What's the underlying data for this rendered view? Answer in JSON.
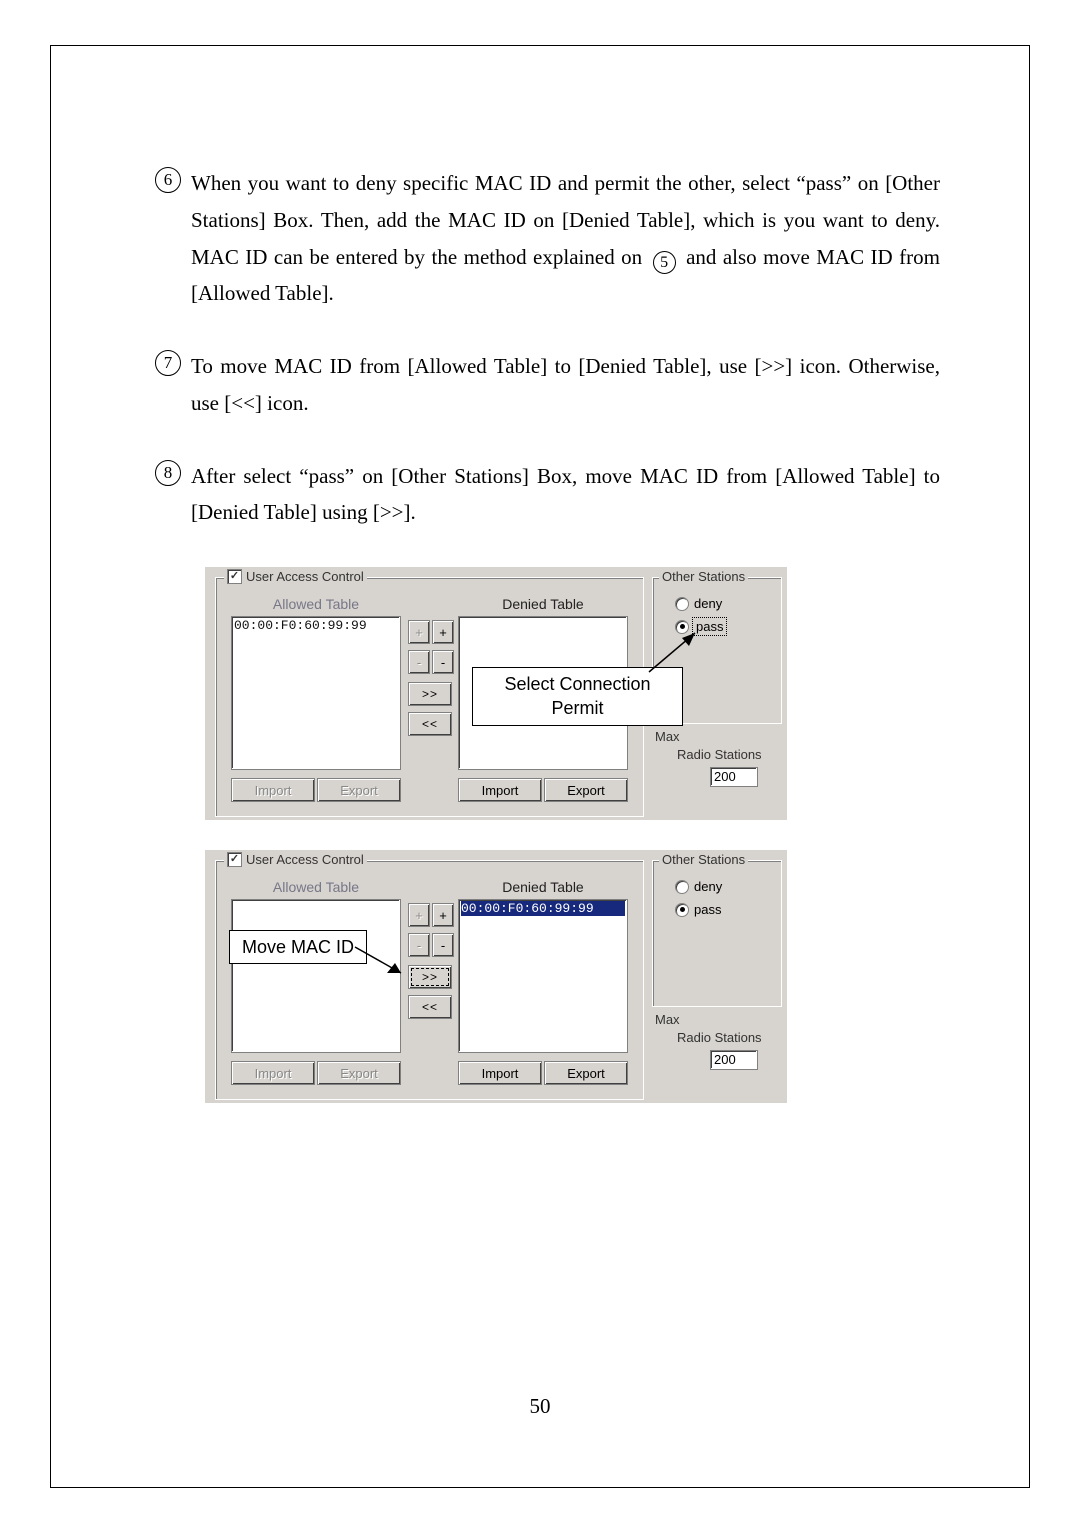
{
  "bullets": {
    "b6": {
      "num": "6",
      "text_a": "When you want to deny specific MAC ID and permit the other, select “pass” on [Other Stations] Box. Then, add the MAC ID on [Denied Table], which is you want to deny. MAC ID can be entered by the method explained on ",
      "ref_num": "5",
      "text_b": " and also move MAC ID from [Allowed Table]."
    },
    "b7": {
      "num": "7",
      "text": "To move MAC ID from [Allowed Table] to [Denied Table], use [>>] icon. Otherwise, use [<<] icon."
    },
    "b8": {
      "num": "8",
      "text": "After select “pass” on [Other Stations] Box, move MAC ID from [Allowed Table] to [Denied Table] using [>>]."
    }
  },
  "ui": {
    "group_title": "User Access Control",
    "allowed_title": "Allowed Table",
    "denied_title": "Denied Table",
    "other_title": "Other Stations",
    "mac_id": "00:00:F0:60:99:99",
    "btn_plus": "+",
    "btn_minus": "-",
    "btn_right": ">>",
    "btn_left": "<<",
    "btn_import": "Import",
    "btn_export": "Export",
    "radio_deny": "deny",
    "radio_pass": "pass",
    "max_label_1": "Max",
    "max_label_2": "Radio Stations",
    "max_value": "200",
    "chk_mark": "✓"
  },
  "callouts": {
    "c1_line1": "Select Connection",
    "c1_line2": "Permit",
    "c2": "Move MAC ID"
  },
  "page_number": "50"
}
